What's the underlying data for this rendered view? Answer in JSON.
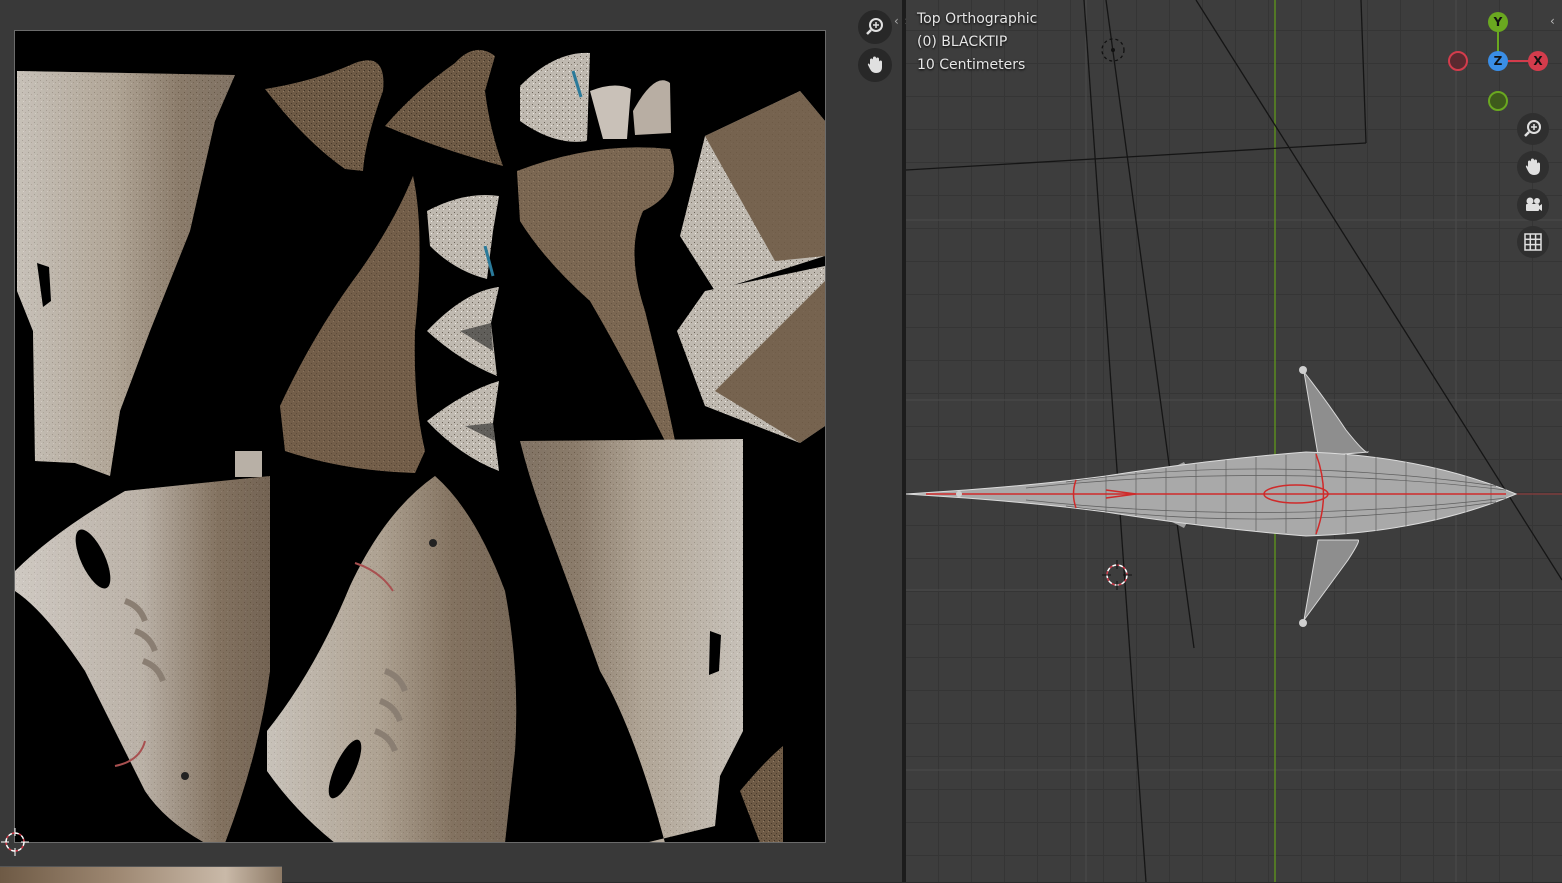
{
  "uv_editor": {
    "tools": [
      {
        "name": "zoom-in-icon",
        "label": "zoom"
      },
      {
        "name": "hand-icon",
        "label": "pan"
      }
    ],
    "split_arrows": "‹ ›"
  },
  "viewport": {
    "view_name": "Top Orthographic",
    "object_label": "(0) BLACKTIP",
    "grid_scale": "10 Centimeters",
    "gizmo": {
      "y_label": "Y",
      "z_label": "Z",
      "x_label": "X"
    },
    "tools": [
      {
        "name": "zoom-in-icon"
      },
      {
        "name": "hand-icon"
      },
      {
        "name": "camera-icon"
      },
      {
        "name": "grid-icon"
      }
    ],
    "corner_arrow": "‹"
  },
  "colors": {
    "uv_background": "#000000",
    "editor_background": "#393939",
    "viewport_background": "#3d3d3d",
    "skin_dark": "#7a6550",
    "skin_light": "#c8c2ba",
    "axis_red": "#d43c4c",
    "axis_green": "#6aa820",
    "axis_blue": "#3a8ee6",
    "seam_red": "#d02a2a",
    "y_axis_line": "#5b8c1e"
  }
}
